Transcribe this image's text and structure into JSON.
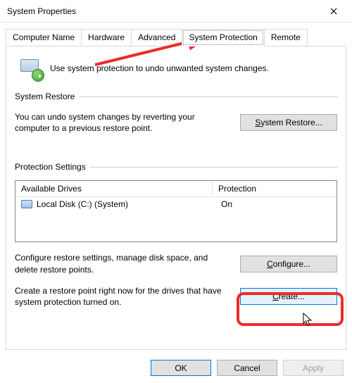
{
  "window": {
    "title": "System Properties"
  },
  "tabs": {
    "computer_name": "Computer Name",
    "hardware": "Hardware",
    "advanced": "Advanced",
    "system_protection": "System Protection",
    "remote": "Remote"
  },
  "intro": "Use system protection to undo unwanted system changes.",
  "restore": {
    "legend": "System Restore",
    "text": "You can undo system changes by reverting your computer to a previous restore point.",
    "button_prefix": "S",
    "button_rest": "ystem Restore..."
  },
  "settings": {
    "legend": "Protection Settings",
    "col_drives": "Available Drives",
    "col_protection": "Protection",
    "drive_label": "Local Disk (C:) (System)",
    "drive_status": "On",
    "configure_text": "Configure restore settings, manage disk space, and delete restore points.",
    "configure_prefix": "C",
    "configure_rest": "onfigure...",
    "create_text": "Create a restore point right now for the drives that have system protection turned on.",
    "create_prefix": "C",
    "create_rest": "reate..."
  },
  "buttons": {
    "ok": "OK",
    "cancel": "Cancel",
    "apply_prefix": "A",
    "apply_rest": "pply"
  }
}
